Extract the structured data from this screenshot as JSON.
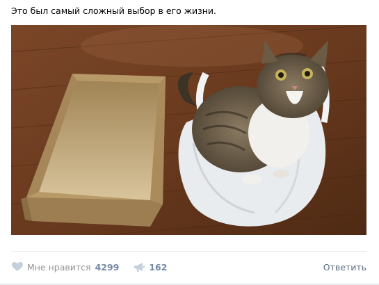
{
  "post": {
    "text": "Это был самый сложный выбор в его жизни.",
    "photo": {
      "description_icon": "cat-photo"
    }
  },
  "actions": {
    "like": {
      "icon": "heart-icon",
      "label": "Мне нравится",
      "count": "4299"
    },
    "share": {
      "icon": "megaphone-icon",
      "count": "162"
    },
    "reply_label": "Ответить"
  },
  "colors": {
    "like_count": "#748aa4",
    "muted_text": "#939393",
    "reply_link": "#5b6c80",
    "divider": "#e7e8ec",
    "floor": "#6b3b1f"
  }
}
